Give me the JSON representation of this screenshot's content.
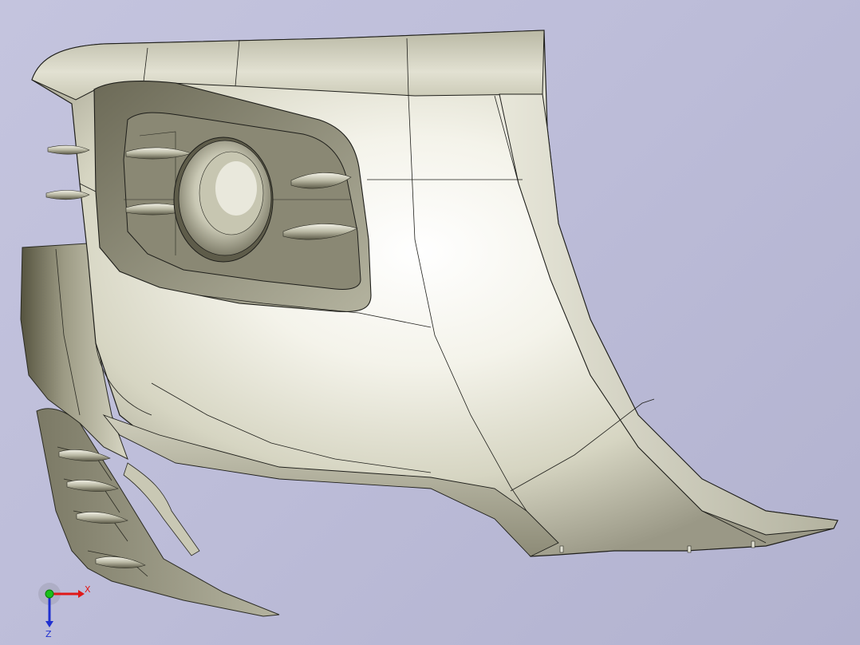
{
  "viewport": {
    "background_top": "#c4c4de",
    "background_bottom": "#b2b2cf"
  },
  "part": {
    "surface_color": "#d9d8c6",
    "highlight_color": "#ffffff",
    "shadow_color": "#6f6c5c",
    "edge_color": "#1e1e1a"
  },
  "triad": {
    "x_label": "X",
    "z_label": "Z",
    "x_color": "#e01818",
    "y_color": "#18c018",
    "z_color": "#2030d0"
  }
}
